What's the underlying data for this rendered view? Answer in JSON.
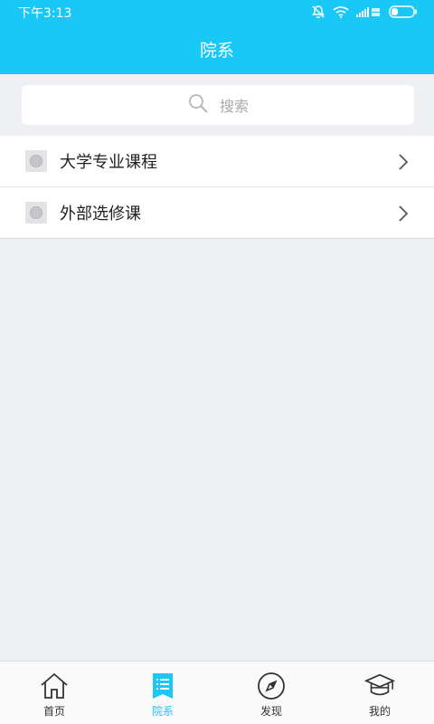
{
  "status_bar": {
    "time": "下午3:13",
    "icons": [
      "bell-off-icon",
      "wifi-icon",
      "signal-icon",
      "battery-icon"
    ]
  },
  "header": {
    "title": "院系"
  },
  "search": {
    "placeholder": "搜索",
    "icon": "search-icon"
  },
  "list": {
    "items": [
      {
        "label": "大学专业课程",
        "icon": "course-thumb-icon"
      },
      {
        "label": "外部选修课",
        "icon": "course-thumb-icon"
      }
    ]
  },
  "tabbar": {
    "active_index": 1,
    "active_color": "#1ac8f8",
    "tabs": [
      {
        "label": "首页",
        "icon": "home-icon"
      },
      {
        "label": "院系",
        "icon": "department-list-icon"
      },
      {
        "label": "发现",
        "icon": "compass-icon"
      },
      {
        "label": "我的",
        "icon": "graduation-cap-icon"
      }
    ]
  },
  "colors": {
    "brand": "#1ac8f8",
    "background": "#eff0f4"
  }
}
